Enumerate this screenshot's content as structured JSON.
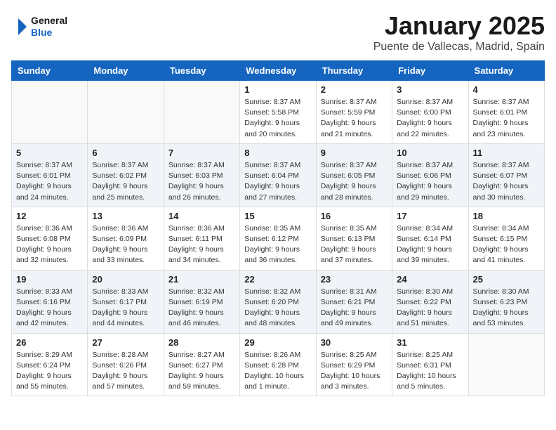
{
  "logo": {
    "line1": "General",
    "line2": "Blue"
  },
  "title": "January 2025",
  "location": "Puente de Vallecas, Madrid, Spain",
  "weekdays": [
    "Sunday",
    "Monday",
    "Tuesday",
    "Wednesday",
    "Thursday",
    "Friday",
    "Saturday"
  ],
  "weeks": [
    [
      {
        "day": "",
        "info": ""
      },
      {
        "day": "",
        "info": ""
      },
      {
        "day": "",
        "info": ""
      },
      {
        "day": "1",
        "info": "Sunrise: 8:37 AM\nSunset: 5:58 PM\nDaylight: 9 hours\nand 20 minutes."
      },
      {
        "day": "2",
        "info": "Sunrise: 8:37 AM\nSunset: 5:59 PM\nDaylight: 9 hours\nand 21 minutes."
      },
      {
        "day": "3",
        "info": "Sunrise: 8:37 AM\nSunset: 6:00 PM\nDaylight: 9 hours\nand 22 minutes."
      },
      {
        "day": "4",
        "info": "Sunrise: 8:37 AM\nSunset: 6:01 PM\nDaylight: 9 hours\nand 23 minutes."
      }
    ],
    [
      {
        "day": "5",
        "info": "Sunrise: 8:37 AM\nSunset: 6:01 PM\nDaylight: 9 hours\nand 24 minutes."
      },
      {
        "day": "6",
        "info": "Sunrise: 8:37 AM\nSunset: 6:02 PM\nDaylight: 9 hours\nand 25 minutes."
      },
      {
        "day": "7",
        "info": "Sunrise: 8:37 AM\nSunset: 6:03 PM\nDaylight: 9 hours\nand 26 minutes."
      },
      {
        "day": "8",
        "info": "Sunrise: 8:37 AM\nSunset: 6:04 PM\nDaylight: 9 hours\nand 27 minutes."
      },
      {
        "day": "9",
        "info": "Sunrise: 8:37 AM\nSunset: 6:05 PM\nDaylight: 9 hours\nand 28 minutes."
      },
      {
        "day": "10",
        "info": "Sunrise: 8:37 AM\nSunset: 6:06 PM\nDaylight: 9 hours\nand 29 minutes."
      },
      {
        "day": "11",
        "info": "Sunrise: 8:37 AM\nSunset: 6:07 PM\nDaylight: 9 hours\nand 30 minutes."
      }
    ],
    [
      {
        "day": "12",
        "info": "Sunrise: 8:36 AM\nSunset: 6:08 PM\nDaylight: 9 hours\nand 32 minutes."
      },
      {
        "day": "13",
        "info": "Sunrise: 8:36 AM\nSunset: 6:09 PM\nDaylight: 9 hours\nand 33 minutes."
      },
      {
        "day": "14",
        "info": "Sunrise: 8:36 AM\nSunset: 6:11 PM\nDaylight: 9 hours\nand 34 minutes."
      },
      {
        "day": "15",
        "info": "Sunrise: 8:35 AM\nSunset: 6:12 PM\nDaylight: 9 hours\nand 36 minutes."
      },
      {
        "day": "16",
        "info": "Sunrise: 8:35 AM\nSunset: 6:13 PM\nDaylight: 9 hours\nand 37 minutes."
      },
      {
        "day": "17",
        "info": "Sunrise: 8:34 AM\nSunset: 6:14 PM\nDaylight: 9 hours\nand 39 minutes."
      },
      {
        "day": "18",
        "info": "Sunrise: 8:34 AM\nSunset: 6:15 PM\nDaylight: 9 hours\nand 41 minutes."
      }
    ],
    [
      {
        "day": "19",
        "info": "Sunrise: 8:33 AM\nSunset: 6:16 PM\nDaylight: 9 hours\nand 42 minutes."
      },
      {
        "day": "20",
        "info": "Sunrise: 8:33 AM\nSunset: 6:17 PM\nDaylight: 9 hours\nand 44 minutes."
      },
      {
        "day": "21",
        "info": "Sunrise: 8:32 AM\nSunset: 6:19 PM\nDaylight: 9 hours\nand 46 minutes."
      },
      {
        "day": "22",
        "info": "Sunrise: 8:32 AM\nSunset: 6:20 PM\nDaylight: 9 hours\nand 48 minutes."
      },
      {
        "day": "23",
        "info": "Sunrise: 8:31 AM\nSunset: 6:21 PM\nDaylight: 9 hours\nand 49 minutes."
      },
      {
        "day": "24",
        "info": "Sunrise: 8:30 AM\nSunset: 6:22 PM\nDaylight: 9 hours\nand 51 minutes."
      },
      {
        "day": "25",
        "info": "Sunrise: 8:30 AM\nSunset: 6:23 PM\nDaylight: 9 hours\nand 53 minutes."
      }
    ],
    [
      {
        "day": "26",
        "info": "Sunrise: 8:29 AM\nSunset: 6:24 PM\nDaylight: 9 hours\nand 55 minutes."
      },
      {
        "day": "27",
        "info": "Sunrise: 8:28 AM\nSunset: 6:26 PM\nDaylight: 9 hours\nand 57 minutes."
      },
      {
        "day": "28",
        "info": "Sunrise: 8:27 AM\nSunset: 6:27 PM\nDaylight: 9 hours\nand 59 minutes."
      },
      {
        "day": "29",
        "info": "Sunrise: 8:26 AM\nSunset: 6:28 PM\nDaylight: 10 hours\nand 1 minute."
      },
      {
        "day": "30",
        "info": "Sunrise: 8:25 AM\nSunset: 6:29 PM\nDaylight: 10 hours\nand 3 minutes."
      },
      {
        "day": "31",
        "info": "Sunrise: 8:25 AM\nSunset: 6:31 PM\nDaylight: 10 hours\nand 5 minutes."
      },
      {
        "day": "",
        "info": ""
      }
    ]
  ]
}
